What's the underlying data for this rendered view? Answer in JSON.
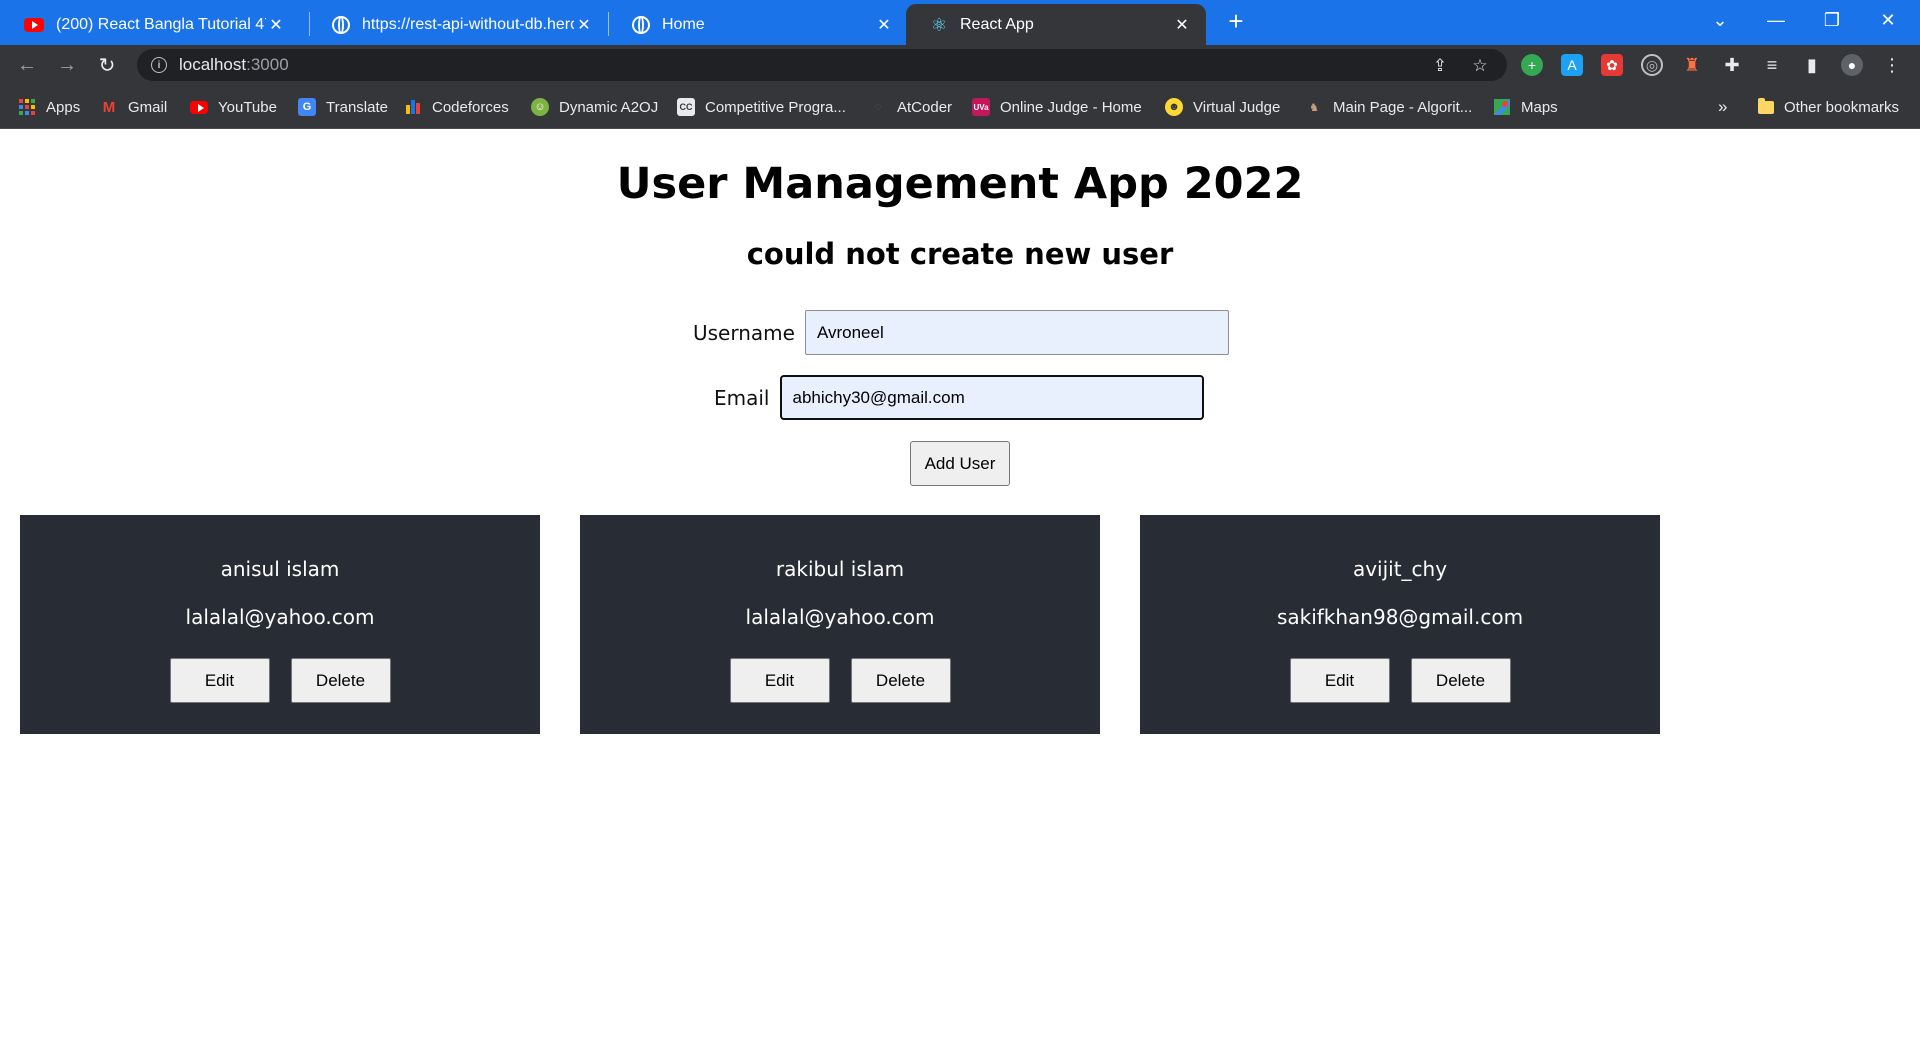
{
  "browser": {
    "tabs": [
      {
        "title": "(200) React Bangla Tutorial 47 : h",
        "icon": "youtube-icon",
        "active": false
      },
      {
        "title": "https://rest-api-without-db.herok",
        "icon": "globe-icon",
        "active": false
      },
      {
        "title": "Home",
        "icon": "globe-icon",
        "active": false
      },
      {
        "title": "React App",
        "icon": "react-icon",
        "active": true
      }
    ],
    "url_host": "localhost",
    "url_port": ":3000",
    "bookmarks": [
      {
        "label": "Apps",
        "icon": "apps-grid-icon"
      },
      {
        "label": "Gmail",
        "icon": "gmail-icon"
      },
      {
        "label": "YouTube",
        "icon": "youtube-icon"
      },
      {
        "label": "Translate",
        "icon": "translate-icon"
      },
      {
        "label": "Codeforces",
        "icon": "codeforces-icon"
      },
      {
        "label": "Dynamic A2OJ",
        "icon": "a2oj-icon"
      },
      {
        "label": "Competitive Progra...",
        "icon": "cc-icon"
      },
      {
        "label": "AtCoder",
        "icon": "atcoder-icon"
      },
      {
        "label": "Online Judge - Home",
        "icon": "uva-icon"
      },
      {
        "label": "Virtual Judge",
        "icon": "vjudge-icon"
      },
      {
        "label": "Main Page - Algorit...",
        "icon": "algorithms-icon"
      },
      {
        "label": "Maps",
        "icon": "maps-icon"
      }
    ],
    "bookmarks_overflow": "»",
    "other_bookmarks": "Other bookmarks"
  },
  "app": {
    "title": "User Management App 2022",
    "status": "could not create new user",
    "form": {
      "username_label": "Username",
      "username_value": "Avroneel",
      "email_label": "Email",
      "email_value": "abhichy30@gmail.com",
      "submit_label": "Add User"
    },
    "users": [
      {
        "name": "anisul islam",
        "email": "lalalal@yahoo.com",
        "edit_label": "Edit",
        "delete_label": "Delete"
      },
      {
        "name": "rakibul islam",
        "email": "lalalal@yahoo.com",
        "edit_label": "Edit",
        "delete_label": "Delete"
      },
      {
        "name": "avijit_chy",
        "email": "sakifkhan98@gmail.com",
        "edit_label": "Edit",
        "delete_label": "Delete"
      }
    ]
  },
  "colors": {
    "tabstrip": "#1a73e8",
    "toolbar": "#35363a",
    "card_bg": "#282c34",
    "input_bg": "#e8f0fe"
  }
}
